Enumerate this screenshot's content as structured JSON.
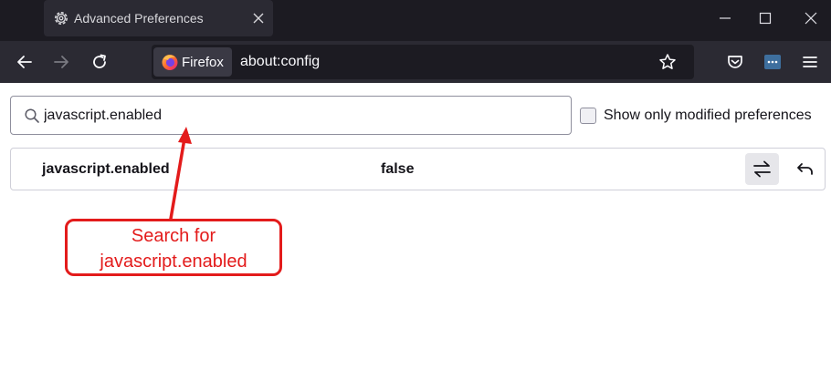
{
  "tab": {
    "title": "Advanced Preferences",
    "icon": "gear-icon"
  },
  "window_controls": [
    "minimize-icon",
    "maximize-icon",
    "close-icon"
  ],
  "toolbar": {
    "identity_label": "Firefox",
    "url": "about:config",
    "icons": [
      "back-arrow-icon",
      "forward-arrow-icon",
      "reload-icon",
      "star-icon",
      "pocket-icon",
      "extension-icon",
      "menu-icon"
    ]
  },
  "search": {
    "value": "javascript.enabled"
  },
  "modified_toggle": {
    "label": "Show only modified preferences",
    "checked": false
  },
  "preference": {
    "name": "javascript.enabled",
    "value": "false"
  },
  "annotation": {
    "line1": "Search for",
    "line2": "javascript.enabled",
    "color": "#e31b1b"
  },
  "colors": {
    "tabstrip": "#1c1b22",
    "toolbar": "#2b2a33",
    "annotation": "#e31b1b"
  }
}
